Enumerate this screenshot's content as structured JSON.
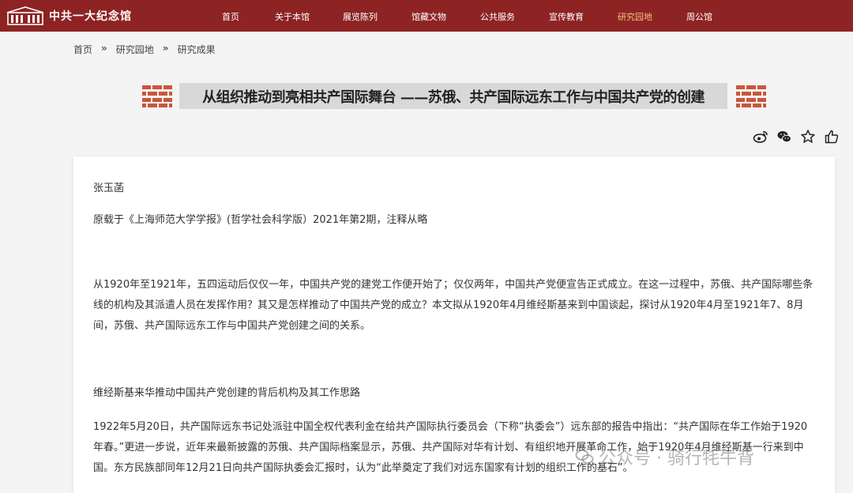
{
  "header": {
    "logo_text": "中共一大纪念馆",
    "nav": [
      {
        "label": "首页"
      },
      {
        "label": "关于本馆"
      },
      {
        "label": "展览陈列"
      },
      {
        "label": "馆藏文物"
      },
      {
        "label": "公共服务"
      },
      {
        "label": "宣传教育"
      },
      {
        "label": "研究园地",
        "active": true
      },
      {
        "label": "周公馆"
      }
    ],
    "colors": {
      "bar": "#8e2323",
      "active": "#f1c27d"
    }
  },
  "breadcrumb": {
    "items": [
      "首页",
      "研究园地",
      "研究成果"
    ],
    "separator": "»"
  },
  "article": {
    "title": "从组织推动到亮相共产国际舞台 ——苏俄、共产国际远东工作与中国共产党的创建",
    "author": "张玉菡",
    "source": "原载于《上海师范大学学报》(哲学社会科学版）2021年第2期，注释从略",
    "para1": "从1920年至1921年，五四运动后仅仅一年，中国共产党的建党工作便开始了；仅仅两年，中国共产党便宣告正式成立。在这一过程中，苏俄、共产国际哪些条线的机构及其派遣人员在发挥作用？其又是怎样推动了中国共产党的成立？本文拟从1920年4月维经斯基来到中国谈起，探讨从1920年4月至1921年7、8月间，苏俄、共产国际远东工作与中国共产党创建之间的关系。",
    "section_heading": "维经斯基来华推动中国共产党创建的背后机构及其工作思路",
    "para2": "1922年5月20日，共产国际远东书记处派驻中国全权代表利金在给共产国际执行委员会（下称“执委会”）远东部的报告中指出：“共产国际在华工作始于1920年春。”更进一步说，近年来最新披露的苏俄、共产国际档案显示，苏俄、共产国际对华有计划、有组织地开展革命工作，始于1920年4月维经斯基一行来到中国。东方民族部同年12月21日向共产国际执委会汇报时，认为“此举奠定了我们对远东国家有计划的组织工作的基石”。"
  },
  "share": {
    "icons": [
      "weibo-icon",
      "wechat-icon",
      "star-icon",
      "thumbs-up-icon"
    ]
  },
  "watermark": {
    "text": "公众号 · 骑行牦牛背"
  }
}
